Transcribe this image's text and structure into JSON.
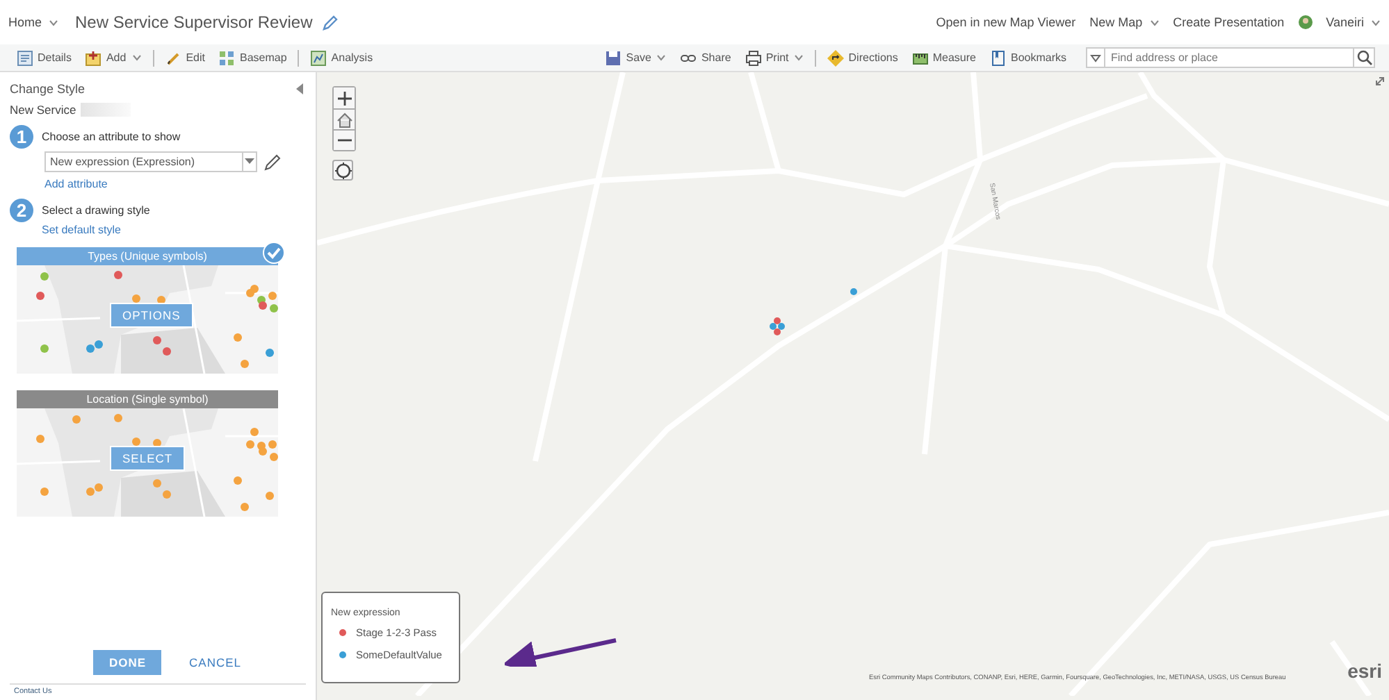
{
  "header": {
    "home": "Home",
    "title": "New Service Supervisor Review",
    "links": [
      "Open in new Map Viewer",
      "New Map",
      "Create Presentation"
    ],
    "user": "Vaneiri"
  },
  "toolbar": {
    "left": [
      {
        "label": "Details",
        "kind": "details",
        "caret": false
      },
      {
        "label": "Add",
        "kind": "add",
        "caret": true
      },
      {
        "label": "Edit",
        "kind": "edit",
        "caret": false
      },
      {
        "label": "Basemap",
        "kind": "basemap",
        "caret": false
      },
      {
        "label": "Analysis",
        "kind": "analysis",
        "caret": false
      }
    ],
    "right": [
      {
        "label": "Save",
        "kind": "save",
        "caret": true
      },
      {
        "label": "Share",
        "kind": "share",
        "caret": false
      },
      {
        "label": "Print",
        "kind": "print",
        "caret": true
      },
      {
        "label": "Directions",
        "kind": "directions",
        "caret": false
      },
      {
        "label": "Measure",
        "kind": "measure",
        "caret": false
      },
      {
        "label": "Bookmarks",
        "kind": "bookmarks",
        "caret": false
      }
    ],
    "search": {
      "placeholder": "Find address or place"
    }
  },
  "panel": {
    "title": "Change Style",
    "layer": "New Service",
    "step1": {
      "number": "1",
      "label": "Choose an attribute to show",
      "value": "New expression (Expression)",
      "link": "Add attribute"
    },
    "step2": {
      "number": "2",
      "label": "Select a drawing style",
      "link": "Set default style"
    },
    "styles": [
      {
        "title": "Types (Unique symbols)",
        "button": "OPTIONS",
        "selected": true,
        "kind": "types"
      },
      {
        "title": "Location (Single symbol)",
        "button": "SELECT",
        "selected": false,
        "kind": "location"
      }
    ],
    "buttons": [
      "DONE",
      "CANCEL"
    ],
    "footer": "Contact Us"
  },
  "map": {
    "street": "San Marcos",
    "legend": {
      "title": "New expression",
      "items": [
        {
          "label": "Stage 1-2-3 Pass",
          "color": "#e05a5a"
        },
        {
          "label": "SomeDefaultValue",
          "color": "#3a9fd6"
        }
      ]
    },
    "attribution": "Esri Community Maps Contributors, CONANP, Esri, HERE, Garmin, Foursquare, GeoTechnologies, Inc, METI/NASA, USGS, US Census Bureau",
    "logo": "esri"
  }
}
